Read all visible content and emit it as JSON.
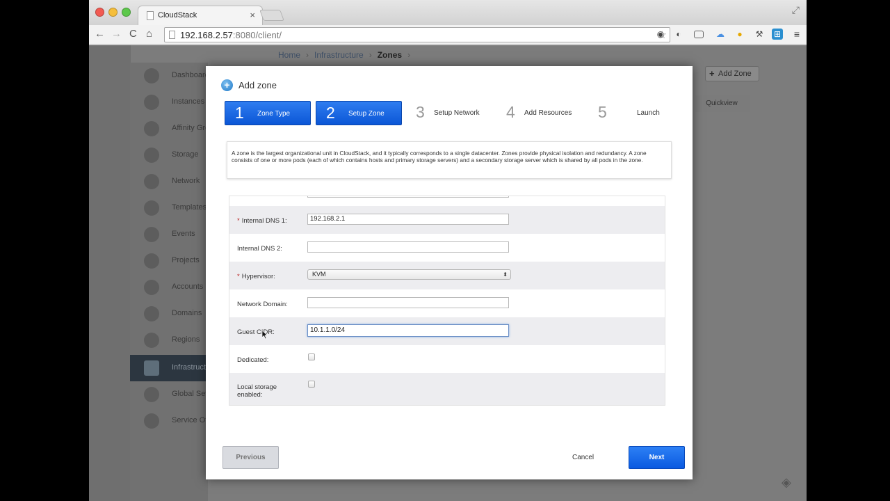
{
  "browser": {
    "tab_title": "CloudStack",
    "tab_close": "×",
    "url_host": "192.168.2.57",
    "url_rest": ":8080/client/",
    "nav": {
      "back": "←",
      "forward": "→",
      "reload": "C",
      "home": "⌂"
    },
    "star": "☆",
    "fullscreen": "⤢"
  },
  "breadcrumb": {
    "items": [
      "Home",
      "Infrastructure"
    ],
    "separator": "›",
    "current": "Zones"
  },
  "sidebar": {
    "items": [
      {
        "label": "Dashboard"
      },
      {
        "label": "Instances"
      },
      {
        "label": "Affinity Groups"
      },
      {
        "label": "Storage"
      },
      {
        "label": "Network"
      },
      {
        "label": "Templates"
      },
      {
        "label": "Events"
      },
      {
        "label": "Projects"
      },
      {
        "label": "Accounts"
      },
      {
        "label": "Domains"
      },
      {
        "label": "Regions"
      },
      {
        "label": "Infrastructure"
      },
      {
        "label": "Global Settings"
      },
      {
        "label": "Service Offerings"
      }
    ]
  },
  "page": {
    "add_zone": "Add Zone",
    "quickview": "Quickview"
  },
  "modal": {
    "title": "Add zone",
    "steps": [
      {
        "num": "1",
        "label": "Zone Type"
      },
      {
        "num": "2",
        "label": "Setup Zone"
      },
      {
        "num": "3",
        "label": "Setup Network"
      },
      {
        "num": "4",
        "label": "Add Resources"
      },
      {
        "num": "5",
        "label": "Launch"
      }
    ],
    "description": "A zone is the largest organizational unit in CloudStack, and it typically corresponds to a single datacenter. Zones provide physical isolation and redundancy. A zone consists of one or more pods (each of which contains hosts and primary storage servers) and a secondary storage server which is shared by all pods in the zone.",
    "form": {
      "required_mark": "*",
      "internal_dns1_label": "Internal DNS 1:",
      "internal_dns1_value": "192.168.2.1",
      "internal_dns2_label": "Internal DNS 2:",
      "internal_dns2_value": "",
      "hypervisor_label": "Hypervisor:",
      "hypervisor_value": "KVM",
      "network_domain_label": "Network Domain:",
      "network_domain_value": "",
      "guest_cidr_label": "Guest CIDR:",
      "guest_cidr_value": "10.1.1.0/24",
      "dedicated_label": "Dedicated:",
      "local_storage_label_line1": "Local storage",
      "local_storage_label_line2": "enabled:"
    },
    "buttons": {
      "previous": "Previous",
      "cancel": "Cancel",
      "next": "Next"
    }
  }
}
